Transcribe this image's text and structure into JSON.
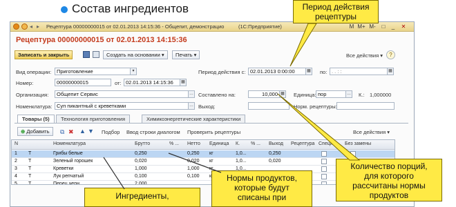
{
  "slide": {
    "top_cut_text": "",
    "bullet_title": "Состав ингредиентов"
  },
  "window": {
    "title": "Рецептура 00000000015 от 02.01.2013 14:15:36 - Общепит, демонстрацио",
    "app_name": "(1С:Предприятие)",
    "controls": [
      "M",
      "M+",
      "M-",
      "□",
      "_",
      "✕"
    ]
  },
  "document": {
    "title": "Рецептура 00000000015 от 02.01.2013 14:15:36"
  },
  "toolbar": {
    "save_close": "Записать и закрыть",
    "create_basis": "Создать на основании ▾",
    "print": "Печать ▾",
    "all_actions": "Все действия ▾",
    "help": "?"
  },
  "form": {
    "operation_label": "Вид операции:",
    "operation_value": "Приготовление",
    "number_label": "Номер:",
    "number_value": "00000000015",
    "date_from_label": "от:",
    "date_value": "02.01.2013 14:15:36",
    "org_label": "Организация:",
    "org_value": "Общепит Сервис",
    "nomenclature_label": "Номенклатура:",
    "nomenclature_value": "Суп пикантный с креветками",
    "period_label": "Период действия с:",
    "period_from": "02.01.2013 0:00:00",
    "period_to_label": "по:",
    "period_to": ". . : :",
    "composed_label": "Составлено на:",
    "composed_value": "10,000",
    "unit_label": "Единица:",
    "unit_value": "пор",
    "k_label": "К.:",
    "k_value": "1,000000",
    "output_label": "Выход:",
    "output_value": "",
    "norm_label": "Норм. рецептуры:",
    "norm_value": ""
  },
  "tabs": [
    "Товары (5)",
    "Технология приготовления",
    "Химикоэнергетические характеристики"
  ],
  "table_toolbar": {
    "add": "Добавить",
    "selection": "Подбор",
    "enter_row": "Ввод строки диалогом",
    "check": "Проверить рецептуры",
    "all_actions": "Все действия ▾"
  },
  "table": {
    "columns": [
      "N",
      "",
      "Номенклатура",
      "Брутто",
      "% ...",
      "Нетто",
      "Единица",
      "К.",
      "% ...",
      "Выход",
      "Рецептура",
      "Специя",
      "",
      "Без замены"
    ],
    "rows": [
      {
        "n": "1",
        "icon": "T",
        "name": "Грибы белые",
        "brutto": "0,250",
        "pct": "",
        "netto": "0,250",
        "unit": "кг",
        "k": "1,0...",
        "pct2": "",
        "out": "0,250"
      },
      {
        "n": "2",
        "icon": "T",
        "name": "Зеленый горошек",
        "brutto": "0,020",
        "pct": "",
        "netto": "0,020",
        "unit": "кг",
        "k": "1,0...",
        "pct2": "",
        "out": "0,020"
      },
      {
        "n": "3",
        "icon": "T",
        "name": "Креветки",
        "brutto": "1,000",
        "pct": "",
        "netto": "1,000",
        "unit": "кг",
        "k": "1,0...",
        "pct2": "",
        "out": ""
      },
      {
        "n": "4",
        "icon": "T",
        "name": "Лук репчатый",
        "brutto": "0,100",
        "pct": "",
        "netto": "0,100",
        "unit": "кг",
        "k": "1,0...",
        "pct2": "",
        "out": ""
      },
      {
        "n": "5",
        "icon": "T",
        "name": "Перец черн...",
        "brutto": "2,000",
        "pct": "",
        "netto": "",
        "unit": "",
        "k": "",
        "pct2": "",
        "out": ""
      }
    ]
  },
  "callouts": {
    "period": "Период действия\nрецептуры",
    "portions": "Количество порций,\nдля которого\nрассчитаны нормы\nпродуктов",
    "norms": "Нормы продуктов,\nкоторые будут\nсписаны при",
    "ingredients": "Ингредиенты,"
  },
  "colors": {
    "callout": "#ffea45",
    "title_red": "#c43b1d",
    "selected_row": "#bcd6f3",
    "titlebar": "#efdc9e"
  }
}
